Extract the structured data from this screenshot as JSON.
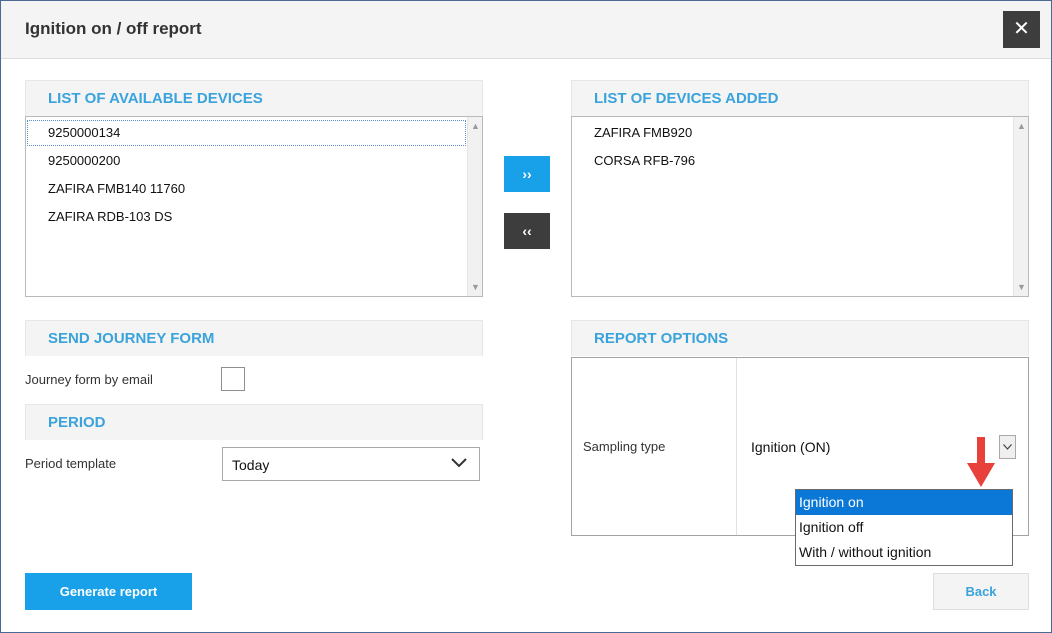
{
  "dialog": {
    "title": "Ignition on / off report",
    "close_glyph": "✕"
  },
  "available_devices": {
    "heading": "LIST OF AVAILABLE DEVICES",
    "items": [
      "9250000134",
      "9250000200",
      "ZAFIRA FMB140 11760",
      "ZAFIRA RDB-103 DS"
    ],
    "focused_index": 0
  },
  "transfer": {
    "add_label": "››",
    "remove_label": "‹‹"
  },
  "added_devices": {
    "heading": "LIST OF DEVICES ADDED",
    "items": [
      "ZAFIRA FMB920",
      "CORSA RFB-796"
    ]
  },
  "journey_form": {
    "heading": "SEND JOURNEY FORM",
    "email_label": "Journey form by email",
    "email_checked": false
  },
  "period": {
    "heading": "PERIOD",
    "template_label": "Period template",
    "template_value": "Today"
  },
  "report_options": {
    "heading": "REPORT OPTIONS",
    "sampling_label": "Sampling type",
    "sampling_value": "Ignition (ON)",
    "sampling_options": [
      "Ignition on",
      "Ignition off",
      "With / without ignition"
    ],
    "highlighted_index": 0
  },
  "footer": {
    "generate_label": "Generate report",
    "back_label": "Back"
  },
  "colors": {
    "accent": "#18a0e8",
    "heading_text": "#3aa3dc",
    "dark_button": "#3d3d3d",
    "selection": "#0b78d7",
    "annotation_arrow": "#e8403a"
  },
  "icons": {
    "close": "close-icon",
    "chevron": "chevron-down-icon",
    "annotation": "arrow-down-icon"
  }
}
